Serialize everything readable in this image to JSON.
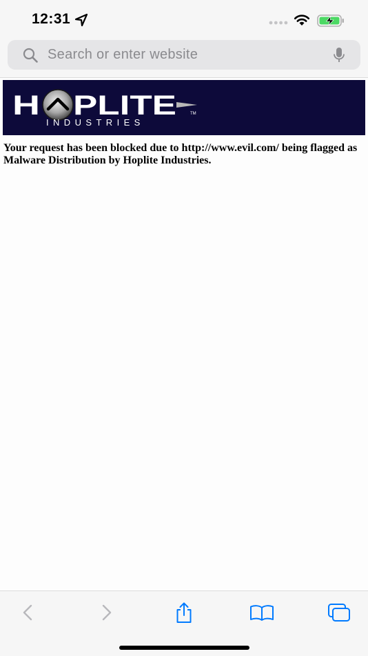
{
  "status_bar": {
    "time": "12:31"
  },
  "url_bar": {
    "placeholder": "Search or enter website"
  },
  "page": {
    "logo_text": "HOPLITE",
    "logo_subtext": "INDUSTRIES",
    "logo_trademark": "TM",
    "message": "Your request has been blocked due to http://www.evil.com/ being flagged as Malware Distribution by Hoplite Industries."
  },
  "colors": {
    "banner_background": "#0d0a3a",
    "accent_blue": "#007aff",
    "battery_green": "#4cd964"
  },
  "toolbar": {
    "icons": [
      "back-icon",
      "forward-icon",
      "share-icon",
      "bookmarks-icon",
      "tabs-icon"
    ]
  }
}
